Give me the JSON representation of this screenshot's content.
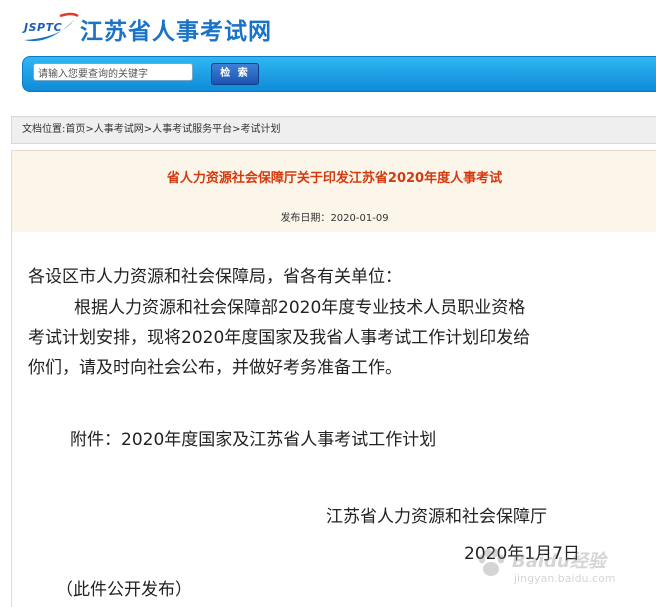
{
  "header": {
    "logo_text": "JSPTC",
    "site_name": "江苏省人事考试网"
  },
  "search": {
    "placeholder": "请输入您要查询的关键字",
    "value": "请输入您要查询的关键字",
    "button_label": "检 索"
  },
  "breadcrumb": {
    "prefix": "文档位置:",
    "items": [
      "首页",
      "人事考试网",
      "人事考试服务平台",
      "考试计划"
    ],
    "separator": ">"
  },
  "article": {
    "title": "省人力资源社会保障厅关于印发江苏省2020年度人事考试",
    "date_label": "发布日期：",
    "date_value": "2020-01-09",
    "salutation": "各设区市人力资源和社会保障局，省各有关单位：",
    "body_lines": [
      "根据人力资源和社会保障部2020年度专业技术人员职业资格",
      "考试计划安排，现将2020年度国家及我省人事考试工作计划印发给",
      "你们，请及时向社会公布，并做好考务准备工作。"
    ],
    "attachment": "附件：2020年度国家及江苏省人事考试工作计划",
    "signature_org": "江苏省人力资源和社会保障厅",
    "signature_date": "2020年1月7日",
    "public_note": "（此件公开发布）"
  },
  "watermark": {
    "text": "Baidu经验",
    "url": "jingyan.baidu.com"
  },
  "colors": {
    "search_bar": "#1a9fe6",
    "title_red": "#d43a0f",
    "site_blue": "#1a73c7",
    "breadcrumb_bg": "#efefef",
    "article_head_bg": "#fbf5ea"
  }
}
